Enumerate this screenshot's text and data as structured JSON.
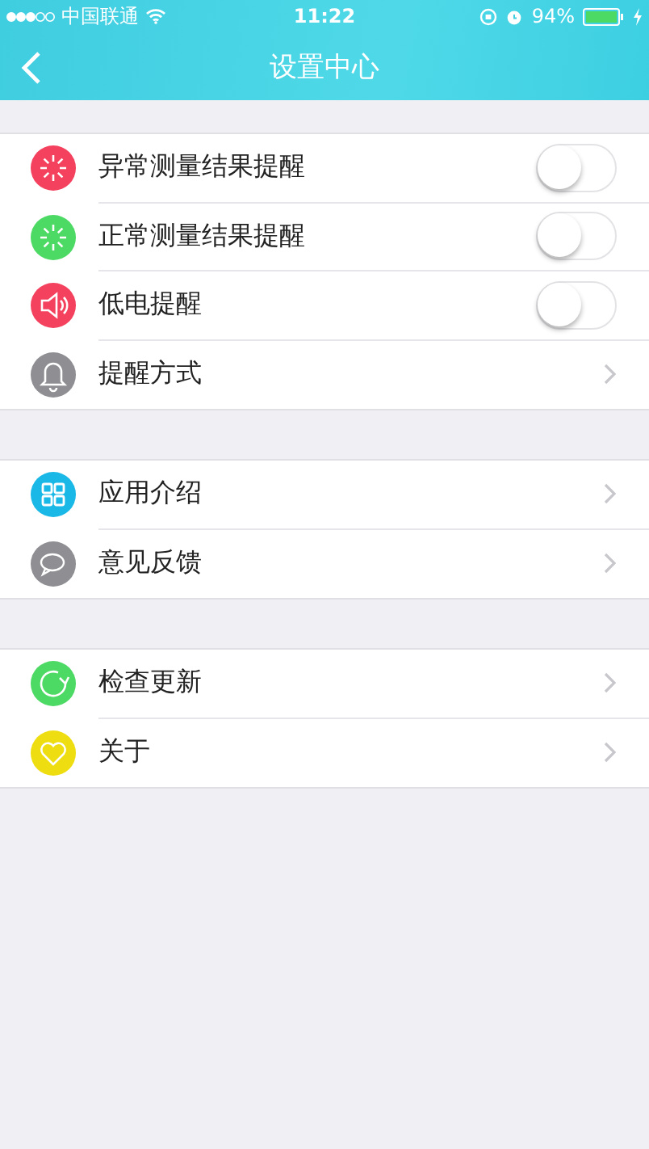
{
  "status_bar": {
    "carrier": "中国联通",
    "time": "11:22",
    "battery": "94%"
  },
  "nav": {
    "title": "设置中心"
  },
  "sections": [
    {
      "rows": [
        {
          "label": "异常测量结果提醒",
          "kind": "toggle",
          "on": false,
          "color": "#f4415e"
        },
        {
          "label": "正常测量结果提醒",
          "kind": "toggle",
          "on": false,
          "color": "#4cd964"
        },
        {
          "label": "低电提醒",
          "kind": "toggle",
          "on": false,
          "color": "#f4415e"
        },
        {
          "label": "提醒方式",
          "kind": "link",
          "color": "#8e8e93"
        }
      ]
    },
    {
      "rows": [
        {
          "label": "应用介绍",
          "kind": "link",
          "color": "#1ab8e6"
        },
        {
          "label": "意见反馈",
          "kind": "link",
          "color": "#8e8e93"
        }
      ]
    },
    {
      "rows": [
        {
          "label": "检查更新",
          "kind": "link",
          "color": "#4cd964"
        },
        {
          "label": "关于",
          "kind": "link",
          "color": "#eedd11"
        }
      ]
    }
  ]
}
